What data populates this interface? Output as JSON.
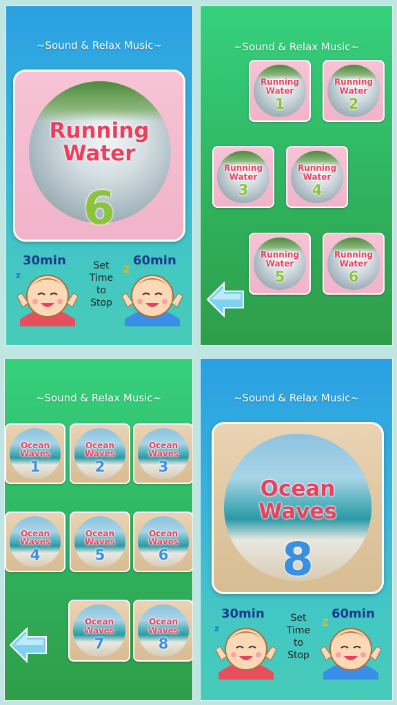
{
  "app_title": "~Sound & Relax Music~",
  "screen1": {
    "sound_name_line1": "Running",
    "sound_name_line2": "Water",
    "track_number": "6",
    "timer_30": "30min",
    "timer_60": "60min",
    "set_time_line1": "Set",
    "set_time_line2": "Time",
    "set_time_line3": "to",
    "set_time_line4": "Stop"
  },
  "screen2": {
    "tiles": [
      {
        "line1": "Running",
        "line2": "Water",
        "number": "1"
      },
      {
        "line1": "Running",
        "line2": "Water",
        "number": "2"
      },
      {
        "line1": "Running",
        "line2": "Water",
        "number": "3"
      },
      {
        "line1": "Running",
        "line2": "Water",
        "number": "4"
      },
      {
        "line1": "Running",
        "line2": "Water",
        "number": "5"
      },
      {
        "line1": "Running",
        "line2": "Water",
        "number": "6"
      }
    ]
  },
  "screen3": {
    "tiles": [
      {
        "line1": "Ocean",
        "line2": "Waves",
        "number": "1"
      },
      {
        "line1": "Ocean",
        "line2": "Waves",
        "number": "2"
      },
      {
        "line1": "Ocean",
        "line2": "Waves",
        "number": "3"
      },
      {
        "line1": "Ocean",
        "line2": "Waves",
        "number": "4"
      },
      {
        "line1": "Ocean",
        "line2": "Waves",
        "number": "5"
      },
      {
        "line1": "Ocean",
        "line2": "Waves",
        "number": "6"
      },
      {
        "line1": "Ocean",
        "line2": "Waves",
        "number": "7"
      },
      {
        "line1": "Ocean",
        "line2": "Waves",
        "number": "8"
      }
    ]
  },
  "screen4": {
    "sound_name_line1": "Ocean",
    "sound_name_line2": "Waves",
    "track_number": "8",
    "timer_30": "30min",
    "timer_60": "60min",
    "set_time_line1": "Set",
    "set_time_line2": "Time",
    "set_time_line3": "to",
    "set_time_line4": "Stop"
  },
  "colors": {
    "label_pink": "#e8405e",
    "number_green": "#8cc33c",
    "number_blue": "#3a8fe0",
    "blue_bg": "#2aa0e2",
    "green_bg": "#2fb35e"
  },
  "icons": [
    "back-arrow-icon",
    "sleeping-baby-30min-icon",
    "sleeping-baby-60min-icon"
  ]
}
